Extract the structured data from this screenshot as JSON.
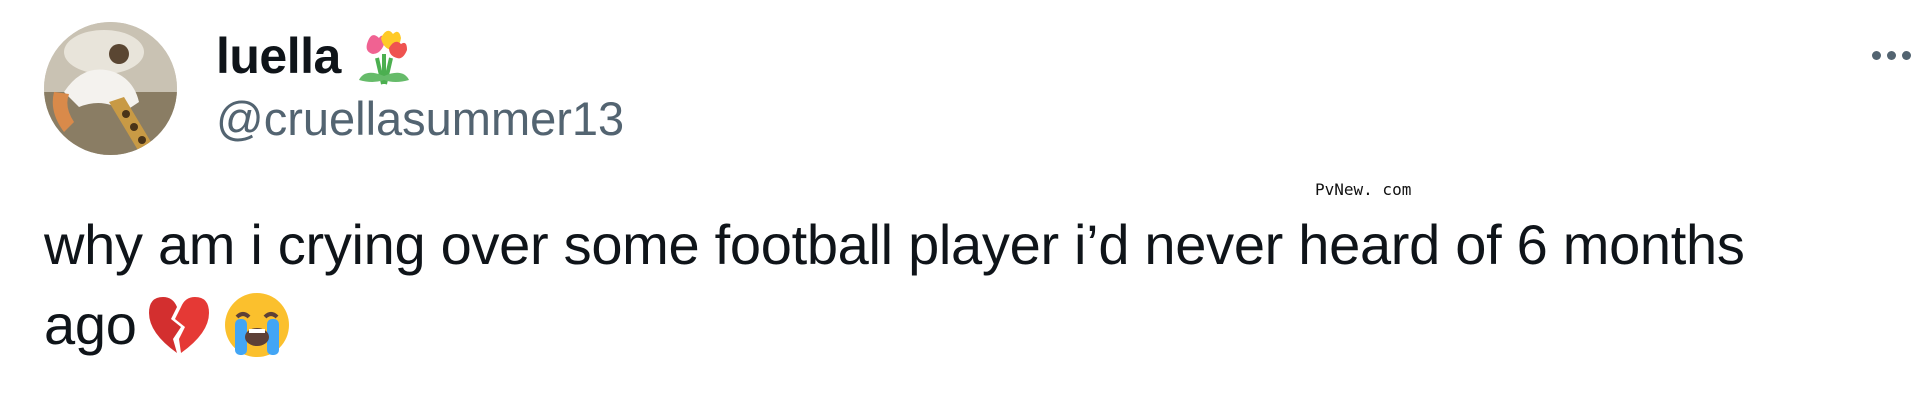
{
  "tweet": {
    "display_name": "luella",
    "display_name_emoji": "tulip-bouquet-icon",
    "handle": "@cruellasummer13",
    "text_line1": "why am i crying over some football player i’d never heard of 6 months",
    "text_line2": "ago",
    "text_emojis": [
      "broken-heart-icon",
      "loudly-crying-face-icon"
    ]
  },
  "watermark": "PvNew. com",
  "colors": {
    "primary_text": "#0f1419",
    "secondary_text": "#536471",
    "background": "#ffffff"
  }
}
